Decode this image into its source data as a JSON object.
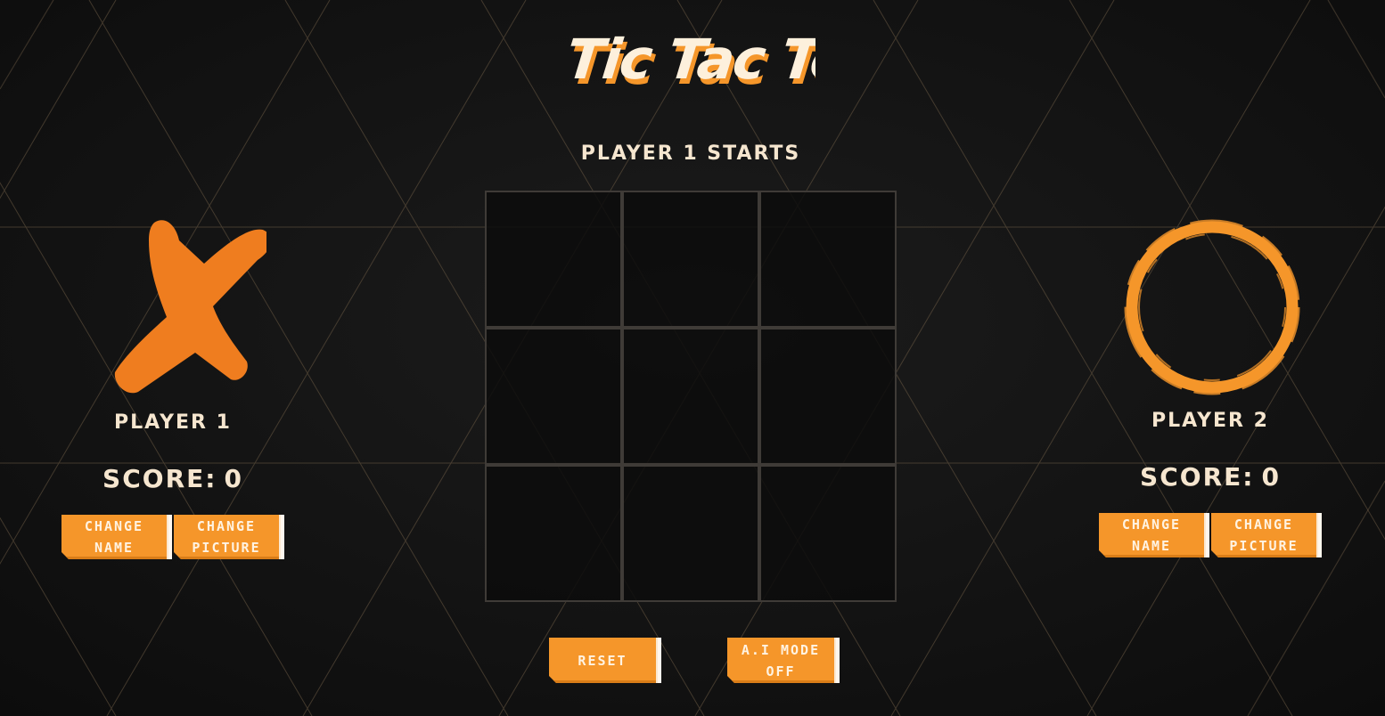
{
  "game": {
    "title": "Tic Tac Toe",
    "status": "Player 1 starts",
    "board": [
      "",
      "",
      "",
      "",
      "",
      "",
      "",
      "",
      ""
    ]
  },
  "players": [
    {
      "symbol": "x-mark-icon",
      "name": "Player 1",
      "score_label": "Score:",
      "score": "0",
      "change_name": "Change\nName",
      "change_picture": "Change\nPicture"
    },
    {
      "symbol": "o-ring-icon",
      "name": "Player 2",
      "score_label": "Score:",
      "score": "0",
      "change_name": "Change\nName",
      "change_picture": "Change\nPicture"
    }
  ],
  "controls": {
    "reset": "Reset",
    "ai_mode": "A.I Mode\nOff"
  },
  "theme": {
    "accent": "#f5962a",
    "mark_orange": "#ef7d1f",
    "text_cream": "#f6e6cf",
    "background": "#121212",
    "grid_line": "#3f3b37"
  }
}
